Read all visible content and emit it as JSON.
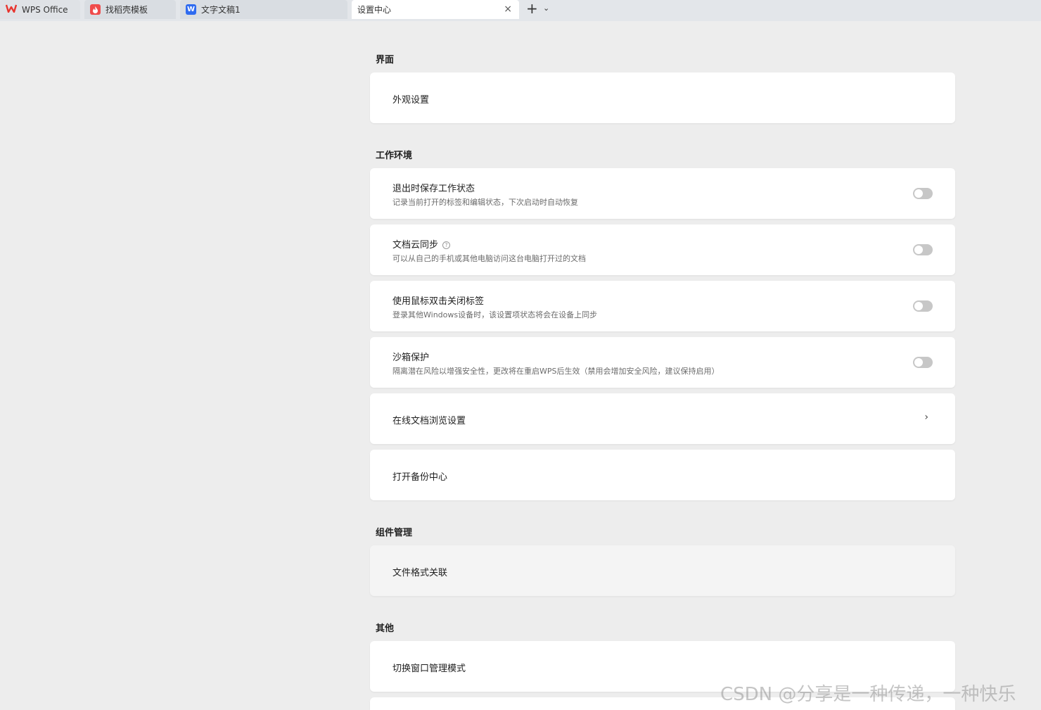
{
  "tabs": [
    {
      "label": "WPS Office",
      "icon": "wps-logo-icon"
    },
    {
      "label": "找稻壳模板",
      "icon": "docer-icon"
    },
    {
      "label": "文字文稿1",
      "icon": "word-doc-icon"
    },
    {
      "label": "设置中心",
      "icon": "",
      "active": true
    }
  ],
  "tabbar": {
    "close_glyph": "×",
    "new_glyph": "+",
    "more_glyph": "⌄"
  },
  "sections": {
    "interface": {
      "title": "界面",
      "items": [
        {
          "title": "外观设置"
        }
      ]
    },
    "work_env": {
      "title": "工作环境",
      "items": [
        {
          "title": "退出时保存工作状态",
          "desc": "记录当前打开的标签和编辑状态，下次启动时自动恢复",
          "control": "toggle",
          "on": false
        },
        {
          "title": "文档云同步",
          "desc": "可以从自己的手机或其他电脑访问这台电脑打开过的文档",
          "control": "toggle",
          "on": false,
          "help": "?"
        },
        {
          "title": "使用鼠标双击关闭标签",
          "desc": "登录其他Windows设备时，该设置项状态将会在设备上同步",
          "control": "toggle",
          "on": false
        },
        {
          "title": "沙箱保护",
          "desc": "隔离潜在风险以增强安全性，更改将在重启WPS后生效（禁用会增加安全风险，建议保持启用）",
          "control": "toggle",
          "on": false
        },
        {
          "title": "在线文档浏览设置",
          "control": "chevron",
          "chevron_glyph": "›"
        },
        {
          "title": "打开备份中心"
        }
      ]
    },
    "components": {
      "title": "组件管理",
      "items": [
        {
          "title": "文件格式关联"
        }
      ]
    },
    "other": {
      "title": "其他",
      "items": [
        {
          "title": "切换窗口管理模式"
        }
      ]
    }
  },
  "watermark": "CSDN @分享是一种传递，一种快乐",
  "colors": {
    "background": "#ededed",
    "card": "#ffffff",
    "tabbar": "#e3e6ea",
    "toggle_off": "#c7c7c7",
    "wps_red": "#e8352f",
    "word_blue": "#2f6bf0",
    "docer_red": "#f04b4b"
  }
}
